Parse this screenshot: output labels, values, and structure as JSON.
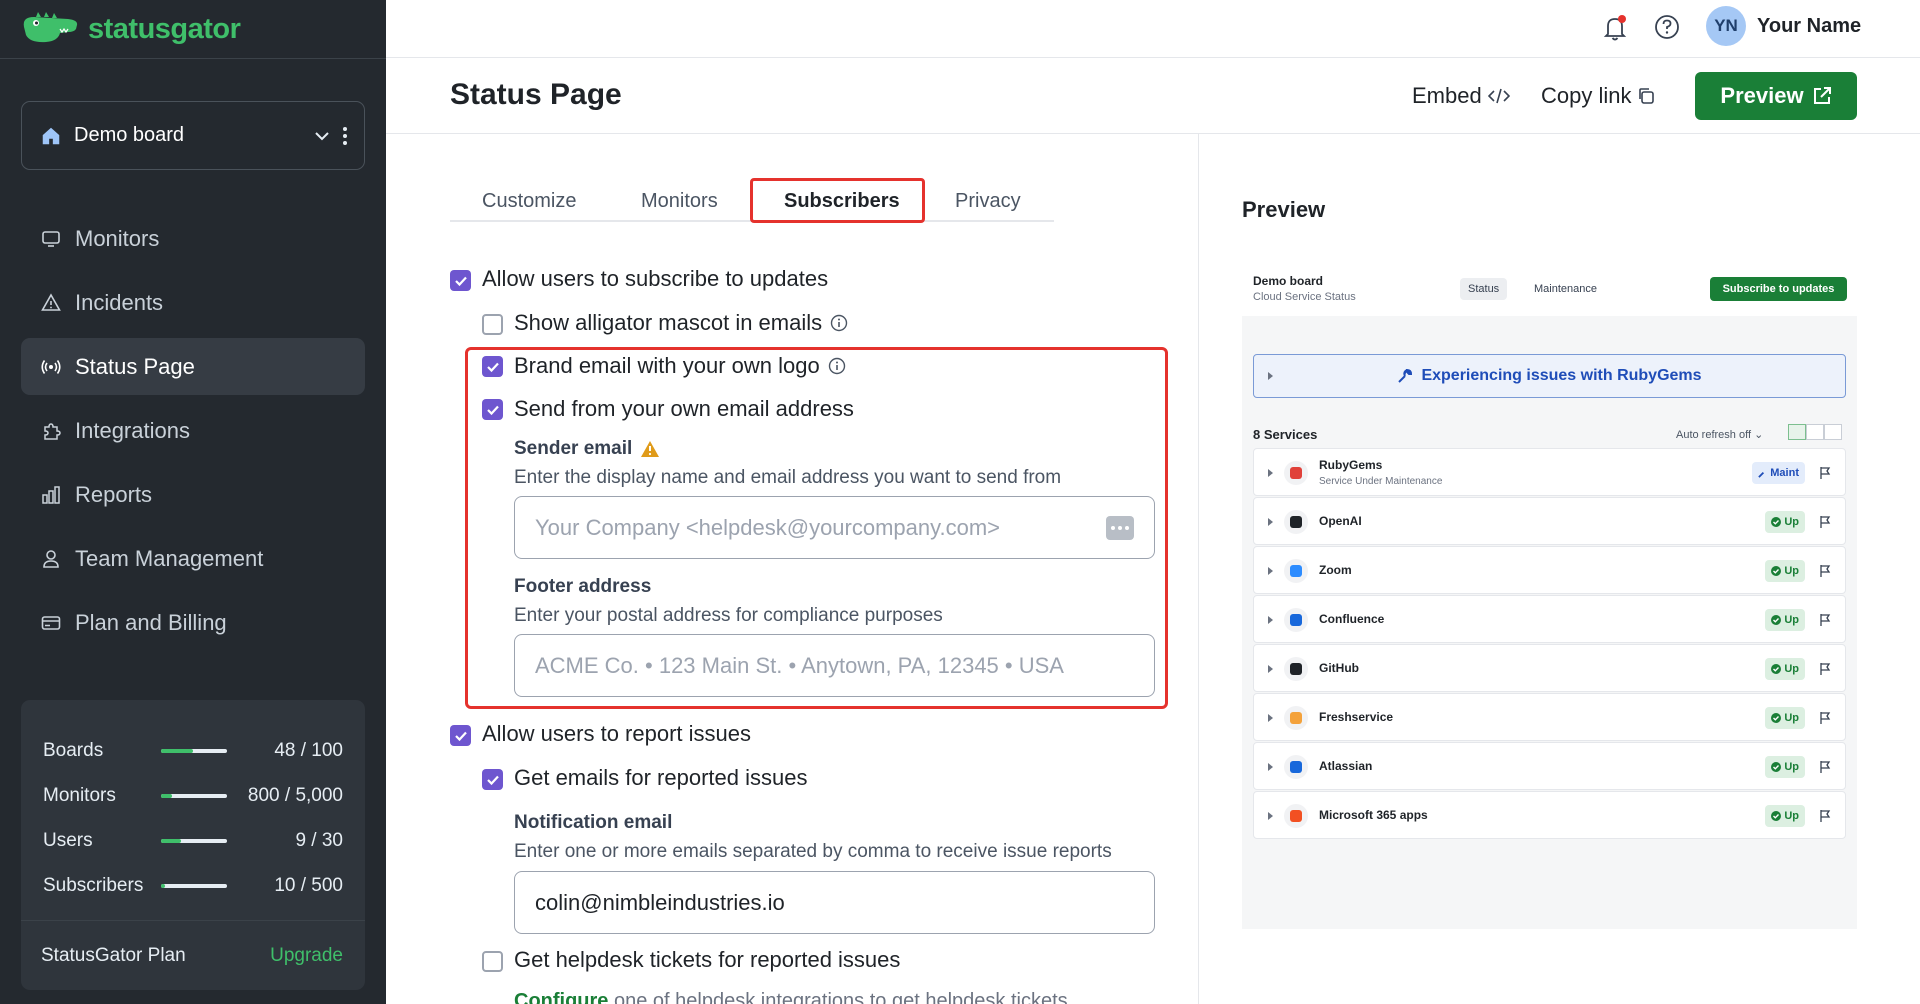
{
  "app": {
    "brand": "statusgator",
    "board_selector": "Demo board"
  },
  "sidebar": {
    "items": [
      {
        "label": "Monitors",
        "icon": "monitor-icon"
      },
      {
        "label": "Incidents",
        "icon": "warning-triangle-icon"
      },
      {
        "label": "Status Page",
        "icon": "broadcast-icon",
        "active": true
      },
      {
        "label": "Integrations",
        "icon": "puzzle-icon"
      },
      {
        "label": "Reports",
        "icon": "bar-chart-icon"
      },
      {
        "label": "Team Management",
        "icon": "user-icon"
      },
      {
        "label": "Plan and Billing",
        "icon": "credit-card-icon"
      }
    ],
    "usage": [
      {
        "label": "Boards",
        "value": "48 / 100",
        "fraction": 0.48
      },
      {
        "label": "Monitors",
        "value": "800 / 5,000",
        "fraction": 0.16
      },
      {
        "label": "Users",
        "value": "9 / 30",
        "fraction": 0.3
      },
      {
        "label": "Subscribers",
        "value": "10 / 500",
        "fraction": 0.02
      }
    ],
    "plan_label": "StatusGator Plan",
    "upgrade_label": "Upgrade"
  },
  "topbar": {
    "avatar_initials": "YN",
    "user_name": "Your Name"
  },
  "header": {
    "title": "Status Page",
    "embed_label": "Embed",
    "copy_link_label": "Copy link",
    "preview_label": "Preview"
  },
  "tabs": [
    {
      "label": "Customize"
    },
    {
      "label": "Monitors"
    },
    {
      "label": "Subscribers",
      "active": true
    },
    {
      "label": "Privacy"
    }
  ],
  "form": {
    "allow_subscribe": {
      "label": "Allow users to subscribe to updates",
      "checked": true
    },
    "show_mascot": {
      "label": "Show alligator mascot in emails",
      "checked": false
    },
    "brand_email": {
      "label": "Brand email with your own logo",
      "checked": true
    },
    "send_from_own": {
      "label": "Send from your own email address",
      "checked": true
    },
    "sender_email": {
      "label": "Sender email",
      "help": "Enter the display name and email address you want to send from",
      "placeholder": "Your Company <helpdesk@yourcompany.com>"
    },
    "footer_address": {
      "label": "Footer address",
      "help": "Enter your postal address for compliance purposes",
      "placeholder": "ACME Co. • 123 Main St. • Anytown, PA, 12345 • USA"
    },
    "allow_report": {
      "label": "Allow users to report issues",
      "checked": true
    },
    "emails_reported": {
      "label": "Get emails for reported issues",
      "checked": true
    },
    "notification_email": {
      "label": "Notification email",
      "help": "Enter one or more emails separated by comma to receive issue reports",
      "value": "colin@nimbleindustries.io"
    },
    "helpdesk_tickets": {
      "label": "Get helpdesk tickets for reported issues",
      "checked": false
    },
    "configure_link": "Configure",
    "configure_rest": "one of helpdesk integrations to get helpdesk tickets"
  },
  "preview": {
    "title": "Preview",
    "board": "Demo board",
    "subtitle": "Cloud Service Status",
    "tab_status": "Status",
    "tab_maintenance": "Maintenance",
    "subscribe_button": "Subscribe to updates",
    "issue_banner": "Experiencing issues with RubyGems",
    "services_count": "8 Services",
    "auto_refresh": "Auto refresh off",
    "services": [
      {
        "name": "RubyGems",
        "desc": "Service Under Maintenance",
        "status": "Maint",
        "icon": "rubygems-icon",
        "color": "#e0413a"
      },
      {
        "name": "OpenAI",
        "desc": "",
        "status": "Up",
        "icon": "openai-icon",
        "color": "#1f2328"
      },
      {
        "name": "Zoom",
        "desc": "",
        "status": "Up",
        "icon": "zoom-icon",
        "color": "#2d8cff"
      },
      {
        "name": "Confluence",
        "desc": "",
        "status": "Up",
        "icon": "confluence-icon",
        "color": "#1868db"
      },
      {
        "name": "GitHub",
        "desc": "",
        "status": "Up",
        "icon": "github-icon",
        "color": "#1f2328"
      },
      {
        "name": "Freshservice",
        "desc": "",
        "status": "Up",
        "icon": "freshservice-icon",
        "color": "#f4a23b"
      },
      {
        "name": "Atlassian",
        "desc": "",
        "status": "Up",
        "icon": "atlassian-icon",
        "color": "#1868db"
      },
      {
        "name": "Microsoft 365 apps",
        "desc": "",
        "status": "Up",
        "icon": "microsoft-icon",
        "color": "#f25022"
      }
    ]
  },
  "colors": {
    "brand_green": "#1a7f37",
    "checkbox_purple": "#6e56cf",
    "highlight_red": "#e5322d",
    "sidebar_bg": "#24292f"
  }
}
